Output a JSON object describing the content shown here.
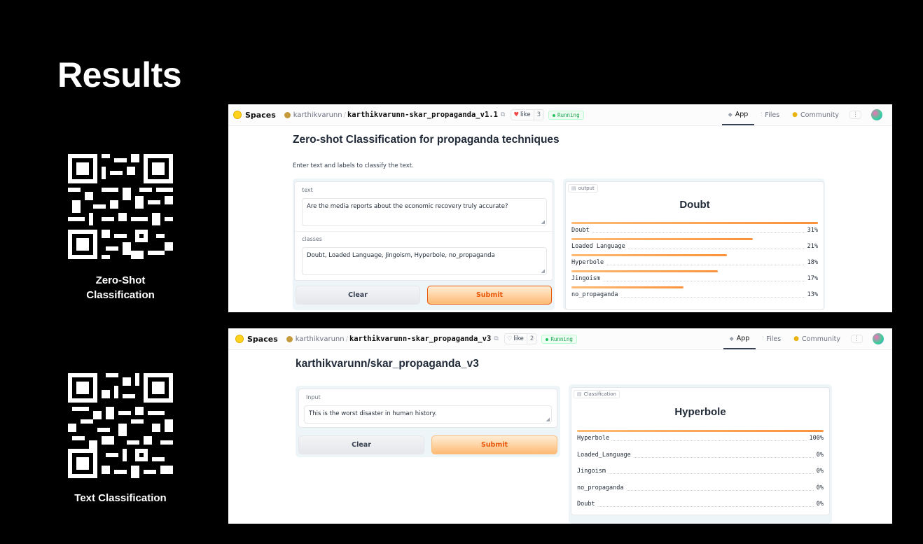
{
  "slide": {
    "title": "Results",
    "qr1_caption": "Zero-Shot\nClassification",
    "qr2_caption": "Text Classification"
  },
  "shot1": {
    "spaces_label": "Spaces",
    "owner": "karthikvarunn",
    "repo": "karthikvarunn-skar_propaganda_v1.1",
    "like_label": "like",
    "like_count": "3",
    "status": "Running",
    "nav": {
      "app": "App",
      "files": "Files",
      "community": "Community"
    },
    "heading": "Zero-shot Classification for propaganda techniques",
    "description": "Enter text and labels to classify the text.",
    "text_label": "text",
    "text_value": "Are the media reports about the economic recovery truly accurate?",
    "classes_label": "classes",
    "classes_value": "Doubt, Loaded Language, Jingoism, Hyperbole, no_propaganda",
    "clear_label": "Clear",
    "submit_label": "Submit",
    "output_tag": "output",
    "output_label": "Doubt",
    "confidences": [
      {
        "label": "Doubt",
        "pct": "31%",
        "value": 0.31
      },
      {
        "label": "Loaded Language",
        "pct": "21%",
        "value": 0.21
      },
      {
        "label": "Hyperbole",
        "pct": "18%",
        "value": 0.18
      },
      {
        "label": "Jingoism",
        "pct": "17%",
        "value": 0.17
      },
      {
        "label": "no_propaganda",
        "pct": "13%",
        "value": 0.13
      }
    ]
  },
  "shot2": {
    "spaces_label": "Spaces",
    "owner": "karthikvarunn",
    "repo": "karthikvarunn-skar_propaganda_v3",
    "like_label": "like",
    "like_count": "2",
    "status": "Running",
    "nav": {
      "app": "App",
      "files": "Files",
      "community": "Community"
    },
    "heading": "karthikvarunn/skar_propaganda_v3",
    "input_label": "Input",
    "input_value": "This is the worst disaster in human history.",
    "clear_label": "Clear",
    "submit_label": "Submit",
    "output_tag": "Classification",
    "output_label": "Hyperbole",
    "confidences": [
      {
        "label": "Hyperbole",
        "pct": "100%",
        "value": 1.0
      },
      {
        "label": "Loaded_Language",
        "pct": "0%",
        "value": 0
      },
      {
        "label": "Jingoism",
        "pct": "0%",
        "value": 0
      },
      {
        "label": "no_propaganda",
        "pct": "0%",
        "value": 0
      },
      {
        "label": "Doubt",
        "pct": "0%",
        "value": 0
      }
    ]
  },
  "colors": {
    "accent": "#fb923c",
    "submit_text": "#ea580c",
    "running": "#16a34a"
  },
  "icons": [
    "qr-code",
    "hf-logo",
    "heart",
    "copy",
    "app-cube",
    "files",
    "community",
    "output-label"
  ]
}
